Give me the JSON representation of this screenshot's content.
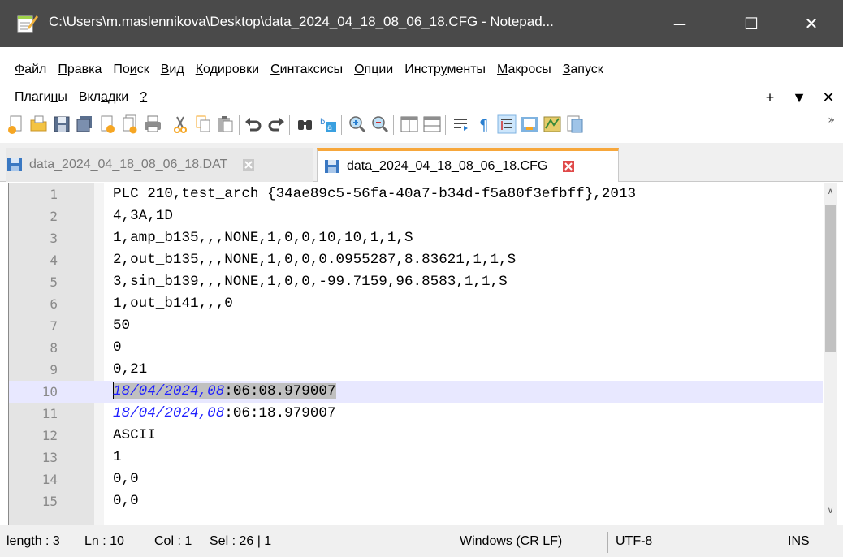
{
  "window": {
    "title": "C:\\Users\\m.maslennikova\\Desktop\\data_2024_04_18_08_06_18.CFG - Notepad...",
    "minimize": "—",
    "maximize": "☐",
    "close": "✕"
  },
  "menu": {
    "row1": [
      {
        "pre": "",
        "u": "Ф",
        "post": "айл"
      },
      {
        "pre": "",
        "u": "П",
        "post": "равка"
      },
      {
        "pre": "По",
        "u": "и",
        "post": "ск"
      },
      {
        "pre": "",
        "u": "В",
        "post": "ид"
      },
      {
        "pre": "",
        "u": "К",
        "post": "одировки"
      },
      {
        "pre": "",
        "u": "С",
        "post": "интаксисы"
      },
      {
        "pre": "",
        "u": "О",
        "post": "пции"
      },
      {
        "pre": "Инстр",
        "u": "у",
        "post": "менты"
      },
      {
        "pre": "",
        "u": "М",
        "post": "акросы"
      },
      {
        "pre": "",
        "u": "З",
        "post": "апуск"
      }
    ],
    "row2": [
      {
        "pre": "Плаги",
        "u": "н",
        "post": "ы"
      },
      {
        "pre": "Вкл",
        "u": "а",
        "post": "дки"
      },
      {
        "pre": "",
        "u": "?",
        "post": ""
      }
    ],
    "right": [
      "+",
      "▼",
      "✕"
    ]
  },
  "toolbar": {
    "icons": [
      "new-file-icon",
      "open-file-icon",
      "save-icon",
      "save-all-icon",
      "close-icon",
      "close-all-icon",
      "print-icon",
      "cut-icon",
      "copy-icon",
      "paste-icon",
      "undo-icon",
      "redo-icon",
      "find-icon",
      "replace-icon",
      "zoom-in-icon",
      "zoom-out-icon",
      "sync-vertical-icon",
      "sync-horizontal-icon",
      "word-wrap-icon",
      "show-all-chars-icon",
      "indent-guide-icon",
      "user-lang-icon",
      "doc-map-icon",
      "function-list-icon"
    ],
    "more": "»"
  },
  "tabs": [
    {
      "label": "data_2024_04_18_08_06_18.DAT",
      "active": false
    },
    {
      "label": "data_2024_04_18_08_06_18.CFG",
      "active": true
    }
  ],
  "editor": {
    "current_line": 10,
    "lines": [
      {
        "n": "1",
        "text": "PLC 210,test_arch {34ae89c5-56fa-40a7-b34d-f5a80f3efbff},2013"
      },
      {
        "n": "2",
        "text": "4,3A,1D"
      },
      {
        "n": "3",
        "text": "1,amp_b135,,,NONE,1,0,0,10,10,1,1,S"
      },
      {
        "n": "4",
        "text": "2,out_b135,,,NONE,1,0,0,0.0955287,8.83621,1,1,S"
      },
      {
        "n": "5",
        "text": "3,sin_b139,,,NONE,1,0,0,-99.7159,96.8583,1,1,S"
      },
      {
        "n": "6",
        "text": "1,out_b141,,,0"
      },
      {
        "n": "7",
        "text": "50"
      },
      {
        "n": "8",
        "text": "0"
      },
      {
        "n": "9",
        "text": "0,21"
      },
      {
        "n": "10",
        "date": "18/04/2024,08",
        "rest": ":06:08.979007"
      },
      {
        "n": "11",
        "date": "18/04/2024,08",
        "rest": ":06:18.979007"
      },
      {
        "n": "12",
        "text": "ASCII"
      },
      {
        "n": "13",
        "text": "1"
      },
      {
        "n": "14",
        "text": "0,0"
      },
      {
        "n": "15",
        "text": "0,0"
      }
    ]
  },
  "status": {
    "length": "length : 3",
    "ln": "Ln : 10",
    "col": "Col : 1",
    "sel": "Sel : 26 | 1",
    "eol": "Windows (CR LF)",
    "encoding": "UTF-8",
    "mode": "INS"
  },
  "colors": {
    "titlebar": "#4a4a4a",
    "tab_accent": "#f7a73b",
    "date_text": "#2020ff",
    "current_line": "#e8e8ff"
  }
}
